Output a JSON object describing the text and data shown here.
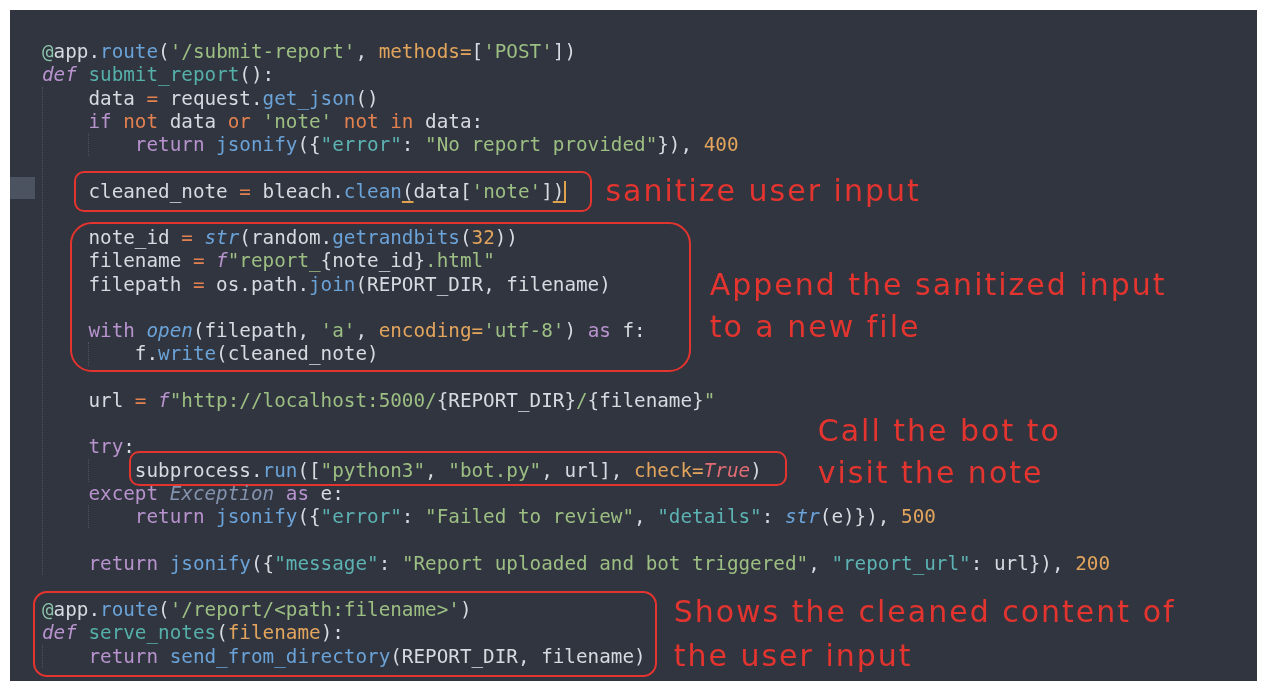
{
  "editor": {
    "lines": [
      {
        "kind": "code",
        "current": false,
        "tokens": [
          {
            "kind": "decorator",
            "text": "@"
          },
          {
            "kind": "plain",
            "text": "app."
          },
          {
            "kind": "call",
            "text": "route"
          },
          {
            "kind": "plain",
            "text": "("
          },
          {
            "kind": "string",
            "text": "'/submit-report'"
          },
          {
            "kind": "plain",
            "text": ", "
          },
          {
            "kind": "argument",
            "text": "methods="
          },
          {
            "kind": "plain",
            "text": "["
          },
          {
            "kind": "string",
            "text": "'POST'"
          },
          {
            "kind": "plain",
            "text": "])"
          }
        ]
      },
      {
        "kind": "code",
        "current": false,
        "tokens": [
          {
            "kind": "storage",
            "text": "def"
          },
          {
            "kind": "definition",
            "text": " submit_report"
          },
          {
            "kind": "plain",
            "text": "():"
          }
        ],
        "children": [
          {
            "kind": "code",
            "current": false,
            "tokens": [
              {
                "kind": "plain",
                "text": "data "
              },
              {
                "kind": "operator",
                "text": "="
              },
              {
                "kind": "plain",
                "text": " request."
              },
              {
                "kind": "call",
                "text": "get_json"
              },
              {
                "kind": "plain",
                "text": "()"
              }
            ]
          },
          {
            "kind": "code",
            "current": false,
            "tokens": [
              {
                "kind": "keyword",
                "text": "if"
              },
              {
                "kind": "operator",
                "text": " not"
              },
              {
                "kind": "plain",
                "text": " data "
              },
              {
                "kind": "operator",
                "text": "or"
              },
              {
                "kind": "string",
                "text": " 'note'"
              },
              {
                "kind": "operator",
                "text": " not in"
              },
              {
                "kind": "plain",
                "text": " data:"
              }
            ],
            "children": [
              {
                "kind": "code",
                "current": false,
                "tokens": [
                  {
                    "kind": "keyword",
                    "text": "return"
                  },
                  {
                    "kind": "call",
                    "text": " jsonify"
                  },
                  {
                    "kind": "plain",
                    "text": "({"
                  },
                  {
                    "kind": "key",
                    "text": "\"error\""
                  },
                  {
                    "kind": "plain",
                    "text": ": "
                  },
                  {
                    "kind": "string",
                    "text": "\"No report provided\""
                  },
                  {
                    "kind": "plain",
                    "text": "}), "
                  },
                  {
                    "kind": "number",
                    "text": "400"
                  }
                ]
              }
            ]
          },
          {
            "kind": "blank"
          },
          {
            "kind": "annotated",
            "note": [
              "sanitize user input"
            ],
            "lines": [
              {
                "kind": "code",
                "current": true,
                "tokens": [
                  {
                    "kind": "plain",
                    "text": "cleaned_note "
                  },
                  {
                    "kind": "operator",
                    "text": "="
                  },
                  {
                    "kind": "plain",
                    "text": " bleach."
                  },
                  {
                    "kind": "call",
                    "text": "clean"
                  },
                  {
                    "kind": "matched_bracket",
                    "text": "("
                  },
                  {
                    "kind": "plain",
                    "text": "data["
                  },
                  {
                    "kind": "string",
                    "text": "'note'"
                  },
                  {
                    "kind": "plain",
                    "text": "]"
                  },
                  {
                    "kind": "matched_bracket",
                    "text": ")"
                  }
                ]
              }
            ]
          },
          {
            "kind": "blank"
          },
          {
            "kind": "annotated",
            "note": [
              "Append the sanitized input",
              "to a new file"
            ],
            "lines": [
              {
                "kind": "code",
                "current": false,
                "tokens": [
                  {
                    "kind": "plain",
                    "text": "note_id "
                  },
                  {
                    "kind": "operator",
                    "text": "="
                  },
                  {
                    "kind": "builtin",
                    "text": " str"
                  },
                  {
                    "kind": "plain",
                    "text": "(random."
                  },
                  {
                    "kind": "call",
                    "text": "getrandbits"
                  },
                  {
                    "kind": "plain",
                    "text": "("
                  },
                  {
                    "kind": "number",
                    "text": "32"
                  },
                  {
                    "kind": "plain",
                    "text": "))"
                  }
                ]
              },
              {
                "kind": "code",
                "current": false,
                "tokens": [
                  {
                    "kind": "plain",
                    "text": "filename "
                  },
                  {
                    "kind": "operator",
                    "text": "="
                  },
                  {
                    "kind": "storage",
                    "text": " f"
                  },
                  {
                    "kind": "string",
                    "text": "\"report_"
                  },
                  {
                    "kind": "plain",
                    "text": "{note_id}"
                  },
                  {
                    "kind": "string",
                    "text": ".html\""
                  }
                ]
              },
              {
                "kind": "code",
                "current": false,
                "tokens": [
                  {
                    "kind": "plain",
                    "text": "filepath "
                  },
                  {
                    "kind": "operator",
                    "text": "="
                  },
                  {
                    "kind": "plain",
                    "text": " os.path."
                  },
                  {
                    "kind": "call",
                    "text": "join"
                  },
                  {
                    "kind": "plain",
                    "text": "(REPORT_DIR, filename)"
                  }
                ]
              },
              {
                "kind": "blank"
              },
              {
                "kind": "code",
                "current": false,
                "tokens": [
                  {
                    "kind": "keyword",
                    "text": "with"
                  },
                  {
                    "kind": "builtin",
                    "text": " open"
                  },
                  {
                    "kind": "plain",
                    "text": "(filepath, "
                  },
                  {
                    "kind": "string",
                    "text": "'a'"
                  },
                  {
                    "kind": "plain",
                    "text": ", "
                  },
                  {
                    "kind": "argument",
                    "text": "encoding="
                  },
                  {
                    "kind": "string",
                    "text": "'utf-8'"
                  },
                  {
                    "kind": "plain",
                    "text": ") "
                  },
                  {
                    "kind": "keyword",
                    "text": "as"
                  },
                  {
                    "kind": "plain",
                    "text": " f:"
                  }
                ],
                "children": [
                  {
                    "kind": "code",
                    "current": false,
                    "tokens": [
                      {
                        "kind": "plain",
                        "text": "f."
                      },
                      {
                        "kind": "call",
                        "text": "write"
                      },
                      {
                        "kind": "plain",
                        "text": "(cleaned_note)"
                      }
                    ]
                  }
                ]
              }
            ]
          },
          {
            "kind": "blank"
          },
          {
            "kind": "code",
            "current": false,
            "tokens": [
              {
                "kind": "plain",
                "text": "url "
              },
              {
                "kind": "operator",
                "text": "="
              },
              {
                "kind": "storage",
                "text": " f"
              },
              {
                "kind": "string",
                "text": "\"http://localhost:5000/"
              },
              {
                "kind": "plain",
                "text": "{REPORT_DIR}"
              },
              {
                "kind": "string",
                "text": "/"
              },
              {
                "kind": "plain",
                "text": "{filename}"
              },
              {
                "kind": "string",
                "text": "\""
              }
            ]
          },
          {
            "kind": "blank"
          },
          {
            "kind": "code",
            "current": false,
            "tokens": [
              {
                "kind": "keyword",
                "text": "try"
              },
              {
                "kind": "plain",
                "text": ":"
              }
            ],
            "children": [
              {
                "kind": "annotated",
                "note": [
                  "Call the bot to",
                  "visit the note"
                ],
                "lines": [
                  {
                    "kind": "code",
                    "current": false,
                    "tokens": [
                      {
                        "kind": "plain",
                        "text": "subprocess."
                      },
                      {
                        "kind": "call",
                        "text": "run"
                      },
                      {
                        "kind": "plain",
                        "text": "(["
                      },
                      {
                        "kind": "string",
                        "text": "\"python3\""
                      },
                      {
                        "kind": "plain",
                        "text": ", "
                      },
                      {
                        "kind": "string",
                        "text": "\"bot.py\""
                      },
                      {
                        "kind": "plain",
                        "text": ", url], "
                      },
                      {
                        "kind": "argument",
                        "text": "check="
                      },
                      {
                        "kind": "constant",
                        "text": "True"
                      },
                      {
                        "kind": "plain",
                        "text": ")"
                      }
                    ]
                  }
                ]
              }
            ]
          },
          {
            "kind": "code",
            "current": false,
            "tokens": [
              {
                "kind": "keyword",
                "text": "except"
              },
              {
                "kind": "class",
                "text": " Exception"
              },
              {
                "kind": "keyword",
                "text": " as"
              },
              {
                "kind": "plain",
                "text": " e:"
              }
            ],
            "children": [
              {
                "kind": "code",
                "current": false,
                "tokens": [
                  {
                    "kind": "keyword",
                    "text": "return"
                  },
                  {
                    "kind": "call",
                    "text": " jsonify"
                  },
                  {
                    "kind": "plain",
                    "text": "({"
                  },
                  {
                    "kind": "key",
                    "text": "\"error\""
                  },
                  {
                    "kind": "plain",
                    "text": ": "
                  },
                  {
                    "kind": "string",
                    "text": "\"Failed to review\""
                  },
                  {
                    "kind": "plain",
                    "text": ", "
                  },
                  {
                    "kind": "key",
                    "text": "\"details\""
                  },
                  {
                    "kind": "plain",
                    "text": ": "
                  },
                  {
                    "kind": "builtin",
                    "text": "str"
                  },
                  {
                    "kind": "plain",
                    "text": "(e)}), "
                  },
                  {
                    "kind": "number",
                    "text": "500"
                  }
                ]
              }
            ]
          },
          {
            "kind": "blank"
          },
          {
            "kind": "code",
            "current": false,
            "tokens": [
              {
                "kind": "keyword",
                "text": "return"
              },
              {
                "kind": "call",
                "text": " jsonify"
              },
              {
                "kind": "plain",
                "text": "({"
              },
              {
                "kind": "key",
                "text": "\"message\""
              },
              {
                "kind": "plain",
                "text": ": "
              },
              {
                "kind": "string",
                "text": "\"Report uploaded and bot triggered\""
              },
              {
                "kind": "plain",
                "text": ", "
              },
              {
                "kind": "key",
                "text": "\"report_url\""
              },
              {
                "kind": "plain",
                "text": ": url}), "
              },
              {
                "kind": "number",
                "text": "200"
              }
            ]
          }
        ]
      },
      {
        "kind": "blank"
      },
      {
        "kind": "annotated",
        "note": [
          "Shows the cleaned content of",
          "the user input"
        ],
        "lines": [
          {
            "kind": "code",
            "current": false,
            "tokens": [
              {
                "kind": "decorator",
                "text": "@"
              },
              {
                "kind": "plain",
                "text": "app."
              },
              {
                "kind": "call",
                "text": "route"
              },
              {
                "kind": "plain",
                "text": "("
              },
              {
                "kind": "string",
                "text": "'/report/<path:filename>'"
              },
              {
                "kind": "plain",
                "text": ")"
              }
            ]
          },
          {
            "kind": "code",
            "current": false,
            "tokens": [
              {
                "kind": "storage",
                "text": "def"
              },
              {
                "kind": "definition",
                "text": " serve_notes"
              },
              {
                "kind": "plain",
                "text": "("
              },
              {
                "kind": "argument",
                "text": "filename"
              },
              {
                "kind": "plain",
                "text": "):"
              }
            ],
            "children": [
              {
                "kind": "code",
                "current": false,
                "tokens": [
                  {
                    "kind": "keyword",
                    "text": "return"
                  },
                  {
                    "kind": "call",
                    "text": " send_from_directory"
                  },
                  {
                    "kind": "plain",
                    "text": "(REPORT_DIR, filename)"
                  }
                ]
              }
            ]
          }
        ]
      }
    ]
  }
}
